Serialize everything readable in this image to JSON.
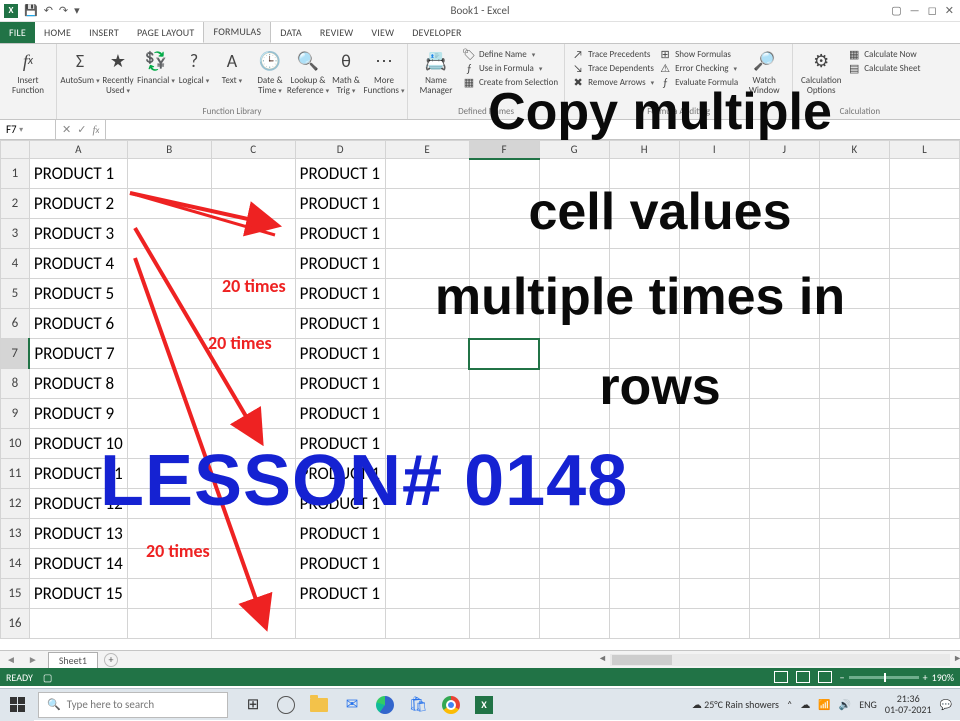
{
  "window": {
    "title": "Book1 - Excel"
  },
  "qat": {
    "save": "💾",
    "undo": "↶",
    "redo": "↷"
  },
  "tabs": [
    "FILE",
    "HOME",
    "INSERT",
    "PAGE LAYOUT",
    "FORMULAS",
    "DATA",
    "REVIEW",
    "VIEW",
    "DEVELOPER"
  ],
  "active_tab": "FORMULAS",
  "ribbon": {
    "insert_fn": {
      "label": "Insert\nFunction",
      "icon": "fx"
    },
    "lib": {
      "group_label": "Function Library",
      "buttons": [
        {
          "label": "AutoSum",
          "icon": "Σ"
        },
        {
          "label": "Recently\nUsed",
          "icon": "★"
        },
        {
          "label": "Financial",
          "icon": "💱"
        },
        {
          "label": "Logical",
          "icon": "?"
        },
        {
          "label": "Text",
          "icon": "A"
        },
        {
          "label": "Date &\nTime",
          "icon": "🕒"
        },
        {
          "label": "Lookup &\nReference",
          "icon": "🔍"
        },
        {
          "label": "Math &\nTrig",
          "icon": "θ"
        },
        {
          "label": "More\nFunctions",
          "icon": "⋯"
        }
      ]
    },
    "names": {
      "group_label": "Defined Names",
      "mgr": {
        "label": "Name\nManager",
        "icon": "📇"
      },
      "rows": [
        "Define Name",
        "Use in Formula",
        "Create from Selection"
      ]
    },
    "audit": {
      "group_label": "Formula Auditing",
      "left": [
        "Trace Precedents",
        "Trace Dependents",
        "Remove Arrows"
      ],
      "right": [
        "Show Formulas",
        "Error Checking",
        "Evaluate Formula"
      ],
      "watch": {
        "label": "Watch\nWindow",
        "icon": "🔎"
      }
    },
    "calc": {
      "group_label": "Calculation",
      "opt": {
        "label": "Calculation\nOptions",
        "icon": "⚙"
      },
      "rows": [
        "Calculate Now",
        "Calculate Sheet"
      ]
    }
  },
  "namebox": "F7",
  "columns": [
    "A",
    "B",
    "C",
    "D",
    "E",
    "F",
    "G",
    "H",
    "I",
    "J",
    "K",
    "L"
  ],
  "selected_col": "F",
  "selected_row": 7,
  "colA": [
    "PRODUCT 1",
    "PRODUCT 2",
    "PRODUCT 3",
    "PRODUCT 4",
    "PRODUCT 5",
    "PRODUCT 6",
    "PRODUCT 7",
    "PRODUCT 8",
    "PRODUCT 9",
    "PRODUCT 10",
    "PRODUCT 11",
    "PRODUCT 12",
    "PRODUCT 13",
    "PRODUCT 14",
    "PRODUCT 15"
  ],
  "colD_value": "PRODUCT 1",
  "row_count": 15,
  "annotations": {
    "times1": "20 times",
    "times2": "20 times",
    "times3": "20 times"
  },
  "overlay": {
    "black_line1": "Copy multiple",
    "black_line2": "cell values",
    "black_line3": "multiple times in",
    "black_line4": "rows",
    "blue": "LESSON# 0148"
  },
  "sheet": {
    "name": "Sheet1"
  },
  "statusbar": {
    "state": "READY",
    "zoom": "190%"
  },
  "taskbar": {
    "search_placeholder": "Type here to search",
    "weather": "25°C Rain showers",
    "lang": "ENG",
    "time": "21:36",
    "date": "01-07-2021"
  }
}
